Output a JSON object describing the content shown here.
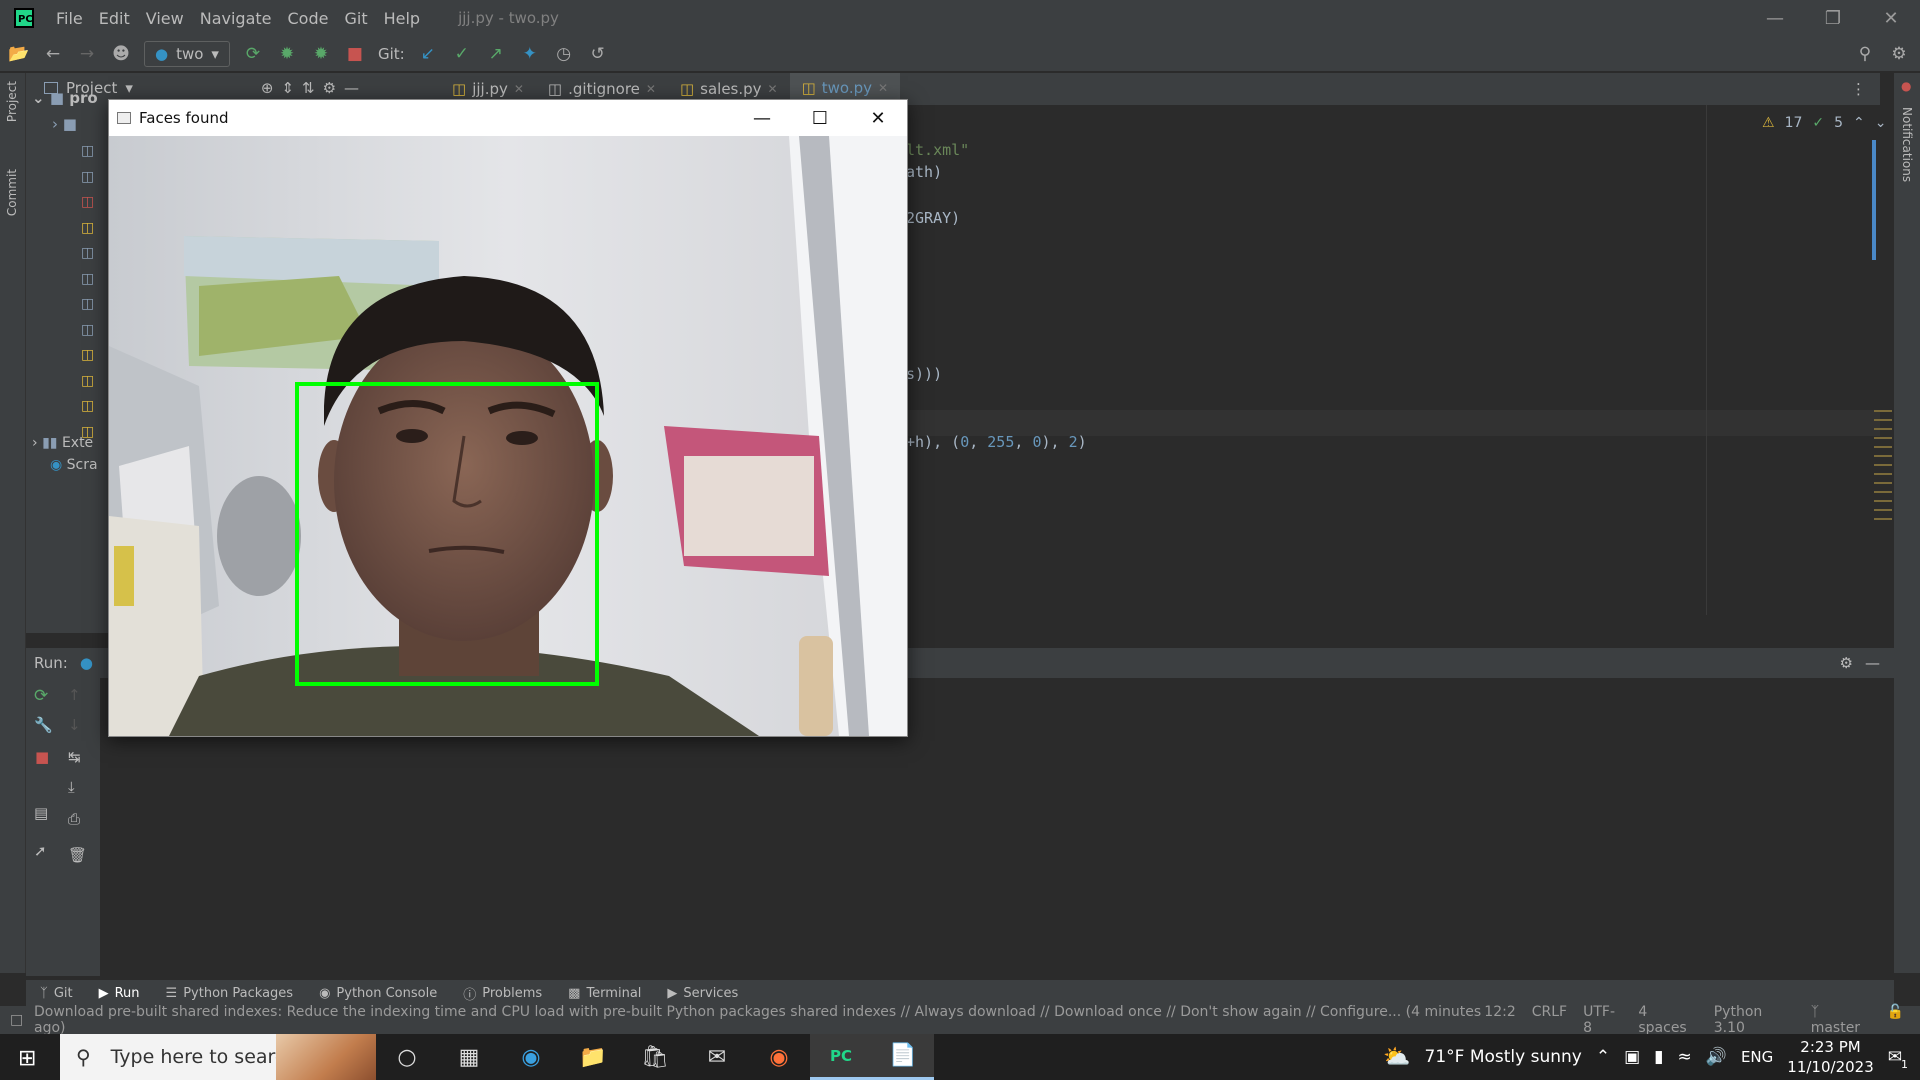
{
  "titlebar": {
    "logo": "PC",
    "menu": [
      "File",
      "Edit",
      "View",
      "Navigate",
      "Code",
      "Git",
      "Help"
    ],
    "title": "jjj.py - two.py"
  },
  "toolbar": {
    "run_config": "two",
    "git_label": "Git:"
  },
  "project_panel": {
    "title": "Project",
    "root": "pro",
    "external": "Exte",
    "scratches": "Scra"
  },
  "left_strip": {
    "project": "Project",
    "commit": "Commit"
  },
  "right_strip": {
    "notifications": "Notifications"
  },
  "tabs": [
    {
      "label": "jjj.py",
      "active": false
    },
    {
      "label": ".gitignore",
      "active": false
    },
    {
      "label": "sales.py",
      "active": false
    },
    {
      "label": "two.py",
      "active": true
    }
  ],
  "editor": {
    "warnings": "17",
    "ok": "5",
    "lines": [
      {
        "segments": [
          {
            "t": "lt.xml\"",
            "c": "str"
          }
        ]
      },
      {
        "segments": [
          {
            "t": "ath)",
            "c": ""
          }
        ]
      },
      {
        "segments": [
          {
            "t": "2GRAY)",
            "c": ""
          }
        ]
      },
      {
        "segments": [
          {
            "t": "s)))",
            "c": ""
          }
        ]
      },
      {
        "segments": [
          {
            "t": "+h), (",
            "c": ""
          },
          {
            "t": "0",
            "c": "num"
          },
          {
            "t": ", ",
            "c": ""
          },
          {
            "t": "255",
            "c": "num"
          },
          {
            "t": ", ",
            "c": ""
          },
          {
            "t": "0",
            "c": "num"
          },
          {
            "t": "), ",
            "c": ""
          },
          {
            "t": "2",
            "c": "num"
          },
          {
            "t": ")",
            "c": ""
          }
        ]
      }
    ]
  },
  "run_panel": {
    "label": "Run:"
  },
  "bottom_tabs": [
    "Git",
    "Run",
    "Python Packages",
    "Python Console",
    "Problems",
    "Terminal",
    "Services"
  ],
  "statusbar": {
    "message": "Download pre-built shared indexes: Reduce the indexing time and CPU load with pre-built Python packages shared indexes // Always download // Download once // Don't show again // Configure... (4 minutes ago)",
    "position": "12:2",
    "line_sep": "CRLF",
    "encoding": "UTF-8",
    "indent": "4 spaces",
    "interpreter": "Python 3.10",
    "branch": "master"
  },
  "face_window": {
    "title": "Faces found"
  },
  "taskbar": {
    "search_placeholder": "Type here to search",
    "weather": "71°F  Mostly sunny",
    "lang": "ENG",
    "time": "2:23 PM",
    "date": "11/10/2023",
    "notif_count": "1"
  },
  "colors": {
    "ide_bg": "#2b2b2b",
    "panel_bg": "#3c3f41",
    "face_box": "#00ff00"
  }
}
